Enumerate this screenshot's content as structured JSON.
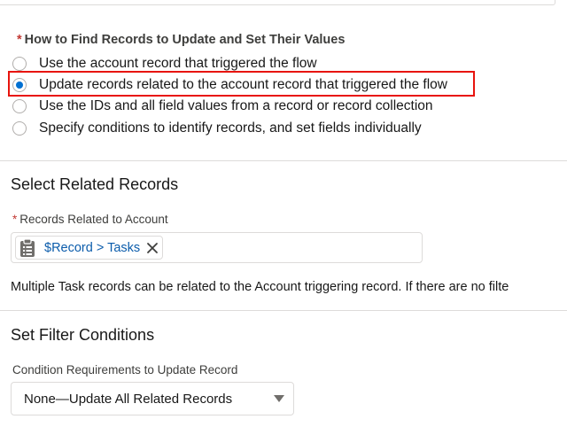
{
  "colors": {
    "accent": "#0070d2",
    "link": "#0b5cab",
    "required": "#c23934",
    "highlight": "#e8140d",
    "border": "#dddbda"
  },
  "find_records": {
    "required_marker": "*",
    "legend": "How to Find Records to Update and Set Their Values",
    "selected_index": 1,
    "options": [
      {
        "label": "Use the account record that triggered the flow",
        "checked": false
      },
      {
        "label": "Update records related to the account record that triggered the flow",
        "checked": true
      },
      {
        "label": "Use the IDs and all field values from a record or record collection",
        "checked": false
      },
      {
        "label": "Specify conditions to identify records, and set fields individually",
        "checked": false
      }
    ]
  },
  "related_records": {
    "section_title": "Select Related Records",
    "required_marker": "*",
    "field_label": "Records Related to Account",
    "pill_icon": "clipboard-icon",
    "pill_label": "$Record > Tasks",
    "pill_remove_icon": "close-icon",
    "help_text": "Multiple Task records can be related to the Account triggering record. If there are no filte"
  },
  "filter_conditions": {
    "section_title": "Set Filter Conditions",
    "field_label": "Condition Requirements to Update Record",
    "selected_value": "None—Update All Related Records",
    "dropdown_icon": "chevron-down-icon"
  }
}
